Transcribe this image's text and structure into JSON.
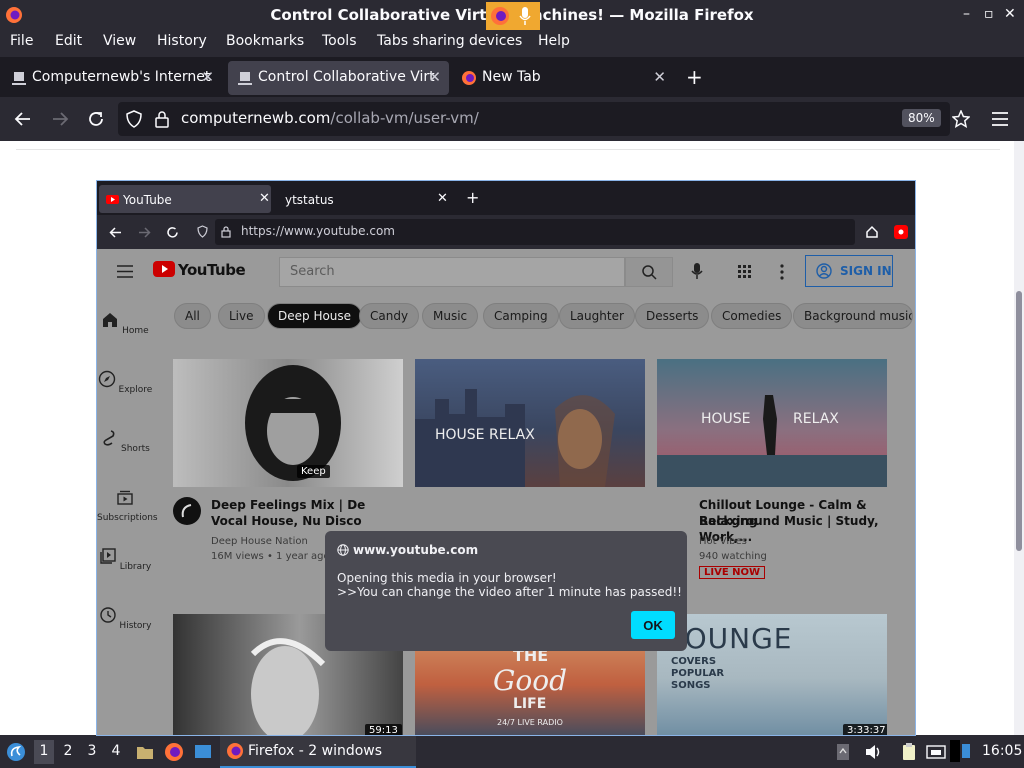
{
  "window": {
    "title": "Control Collaborative Virtual Machines! — Mozilla Firefox",
    "minimize": "–",
    "maximize": "▫",
    "close": "✕"
  },
  "menu": [
    "File",
    "Edit",
    "View",
    "History",
    "Bookmarks",
    "Tools",
    "Tabs sharing devices",
    "Help"
  ],
  "tabs": [
    {
      "label": "Computernewb's Internet"
    },
    {
      "label": "Control Collaborative Virt"
    },
    {
      "label": "New Tab"
    }
  ],
  "new_tab": "+",
  "url": {
    "host": "computernewb.com",
    "path": "/collab-vm/user-vm/"
  },
  "zoom": "80%",
  "vm": {
    "tabs": [
      "YouTube",
      "ytstatus"
    ],
    "url": "https://www.youtube.com",
    "youtube": {
      "search_placeholder": "Search",
      "sign_in": "SIGN IN",
      "chips": [
        "All",
        "Live",
        "Deep House",
        "Candy",
        "Music",
        "Camping",
        "Laughter",
        "Desserts",
        "Comedies",
        "Background music"
      ],
      "sidebar": [
        "Home",
        "Explore",
        "Shorts",
        "Subscriptions",
        "Library",
        "History"
      ],
      "videos": [
        {
          "title": "Deep Feelings Mix | De",
          "title2": "Vocal House, Nu Disco",
          "channel": "Deep House Nation",
          "meta": "16M views • 1 year ago",
          "badge": "Keep"
        },
        {
          "thumb_text": "HOUSE RELAX"
        },
        {
          "title": "Chillout Lounge - Calm & Relaxing",
          "title2": "Background Music | Study, Work,...",
          "channel": "Hot Vibes",
          "meta": "940 watching",
          "live": "LIVE NOW",
          "thumb_text1": "HOUSE",
          "thumb_text2": "RELAX"
        },
        {
          "duration": "59:13"
        },
        {
          "thumb_text1": "THE",
          "thumb_text2": "Good",
          "thumb_text3": "LIFE",
          "thumb_text4": "24/7 LIVE RADIO"
        },
        {
          "duration": "3:33:37",
          "thumb_text1": "LOUNGE",
          "thumb_text2": "COVERS",
          "thumb_text3": "POPULAR",
          "thumb_text4": "SONGS"
        }
      ]
    },
    "dialog": {
      "host": "www.youtube.com",
      "message": "Opening this media in your browser!\n>>You can change the video after 1 minute has passed!!",
      "ok": "OK"
    }
  },
  "taskbar": {
    "workspaces": [
      "1",
      "2",
      "3",
      "4"
    ],
    "task": "Firefox - 2 windows",
    "clock": "16:05"
  },
  "colors": {
    "accent": "#00ddff",
    "firefox_bg": "#2b2a33",
    "youtube_red": "#ff0000"
  }
}
